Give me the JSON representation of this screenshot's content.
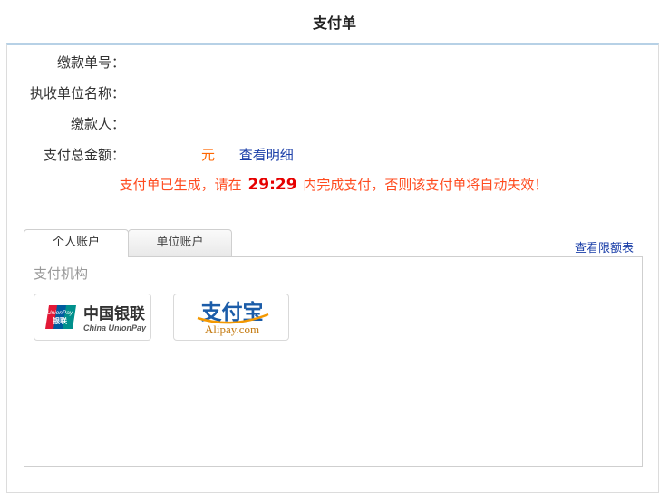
{
  "page": {
    "title": "支付单"
  },
  "fields": {
    "bill_no": {
      "label": "缴款单号：",
      "value": ""
    },
    "unit_name": {
      "label": "执收单位名称：",
      "value": ""
    },
    "payer": {
      "label": "缴款人：",
      "value": ""
    },
    "amount": {
      "label": "支付总金额：",
      "value": "",
      "currency": "元",
      "detail_link": "查看明细"
    }
  },
  "notice": {
    "prefix": "支付单已生成，请在",
    "countdown": "29:29",
    "suffix": "内完成支付，否则该支付单将自动失效！"
  },
  "tabs": [
    {
      "label": "个人账户",
      "active": true
    },
    {
      "label": "单位账户",
      "active": false
    }
  ],
  "limit_link": "查看限额表",
  "payment": {
    "section_label": "支付机构",
    "options": [
      {
        "name": "unionpay",
        "cn": "中国银联",
        "en": "China UnionPay",
        "badge_top": "UnionPay",
        "badge_bottom": "银联"
      },
      {
        "name": "alipay",
        "cn": "支付宝",
        "en": "Alipay.com"
      }
    ]
  },
  "colors": {
    "notice": "#ff4b1f",
    "countdown": "#e60000",
    "link": "#1a3ea8",
    "currency": "#ff6600",
    "alipay_blue": "#1b5ca8",
    "alipay_orange": "#f39800",
    "unionpay_red": "#e21836",
    "unionpay_blue": "#005b9f",
    "unionpay_teal": "#00908c"
  }
}
